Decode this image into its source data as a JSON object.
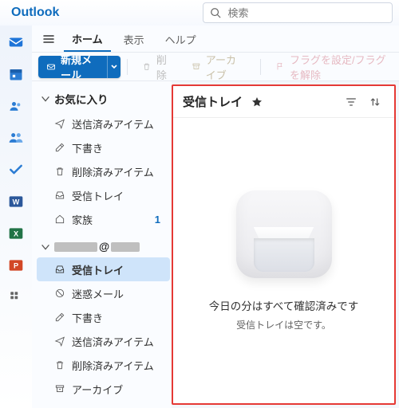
{
  "brand": "Outlook",
  "search": {
    "placeholder": "検索"
  },
  "tabs": {
    "home": "ホーム",
    "view": "表示",
    "help": "ヘルプ"
  },
  "commands": {
    "new_mail": "新規メール",
    "delete": "削除",
    "archive": "アーカイブ",
    "flag": "フラグを設定/フラグを解除"
  },
  "favorites": {
    "header": "お気に入り",
    "sent": "送信済みアイテム",
    "drafts": "下書き",
    "deleted": "削除済みアイテム",
    "inbox": "受信トレイ",
    "family": "家族",
    "family_badge": "1"
  },
  "account": {
    "header_masked": "@",
    "inbox": "受信トレイ",
    "junk": "迷惑メール",
    "drafts": "下書き",
    "sent": "送信済みアイテム",
    "deleted": "削除済みアイテム",
    "archive": "アーカイブ"
  },
  "list": {
    "title": "受信トレイ",
    "empty_title": "今日の分はすべて確認済みです",
    "empty_sub": "受信トレイは空です。"
  },
  "apprail_icons": [
    "mail",
    "calendar",
    "people",
    "groups",
    "todo",
    "word",
    "excel",
    "powerpoint",
    "more-apps"
  ]
}
